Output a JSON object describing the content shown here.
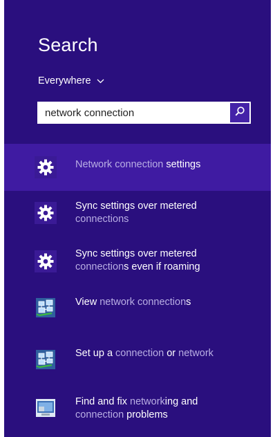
{
  "charm": {
    "title": "Search",
    "scope": "Everywhere",
    "background": "#2a0f7e",
    "selected_background": "#3f1ba2"
  },
  "search": {
    "value": "network connection",
    "button_icon": "search-icon"
  },
  "results": [
    {
      "icon": "gear-icon",
      "line1": [
        "Network connection",
        " settings"
      ],
      "line2": []
    },
    {
      "icon": "gear-icon",
      "line1": [
        "Sync settings over metered"
      ],
      "line2": [
        "connection",
        "s"
      ]
    },
    {
      "icon": "gear-icon",
      "line1": [
        "Sync settings over metered"
      ],
      "line2": [
        "connection",
        "s even if roaming"
      ]
    },
    {
      "icon": "network-connections-icon",
      "line1": [
        "View ",
        "network connection",
        "s"
      ],
      "line2": []
    },
    {
      "icon": "network-connections-icon",
      "line1": [
        "Set up a ",
        "connection",
        " or ",
        "network"
      ],
      "line2": []
    },
    {
      "icon": "troubleshoot-network-icon",
      "line1": [
        "Find and fix ",
        "network",
        "ing and"
      ],
      "line2": [
        "connection",
        " problems"
      ]
    }
  ]
}
